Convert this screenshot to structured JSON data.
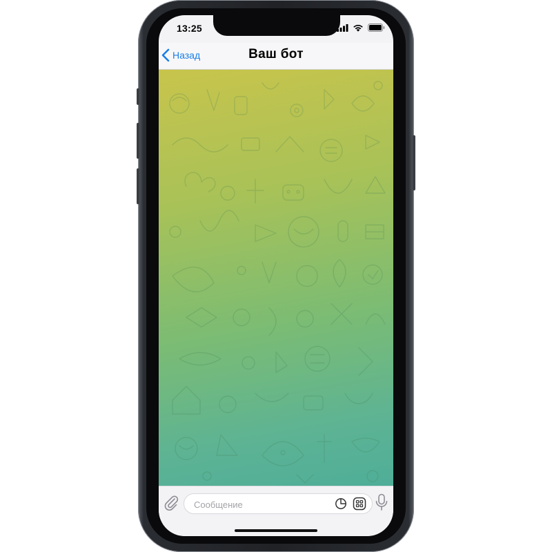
{
  "status_bar": {
    "time": "13:25",
    "icons": [
      "cellular-signal-icon",
      "wifi-icon",
      "battery-icon"
    ]
  },
  "nav": {
    "back_label": "Назад",
    "title": "Ваш бот"
  },
  "composer": {
    "placeholder": "Сообщение",
    "value": "",
    "icons": [
      "paperclip-icon",
      "sticker-icon",
      "keyboard-icon",
      "microphone-icon"
    ]
  },
  "colors": {
    "accent": "#1a7ee6",
    "wallpaper_top": "#c8c44c",
    "wallpaper_bottom": "#4fae98"
  }
}
